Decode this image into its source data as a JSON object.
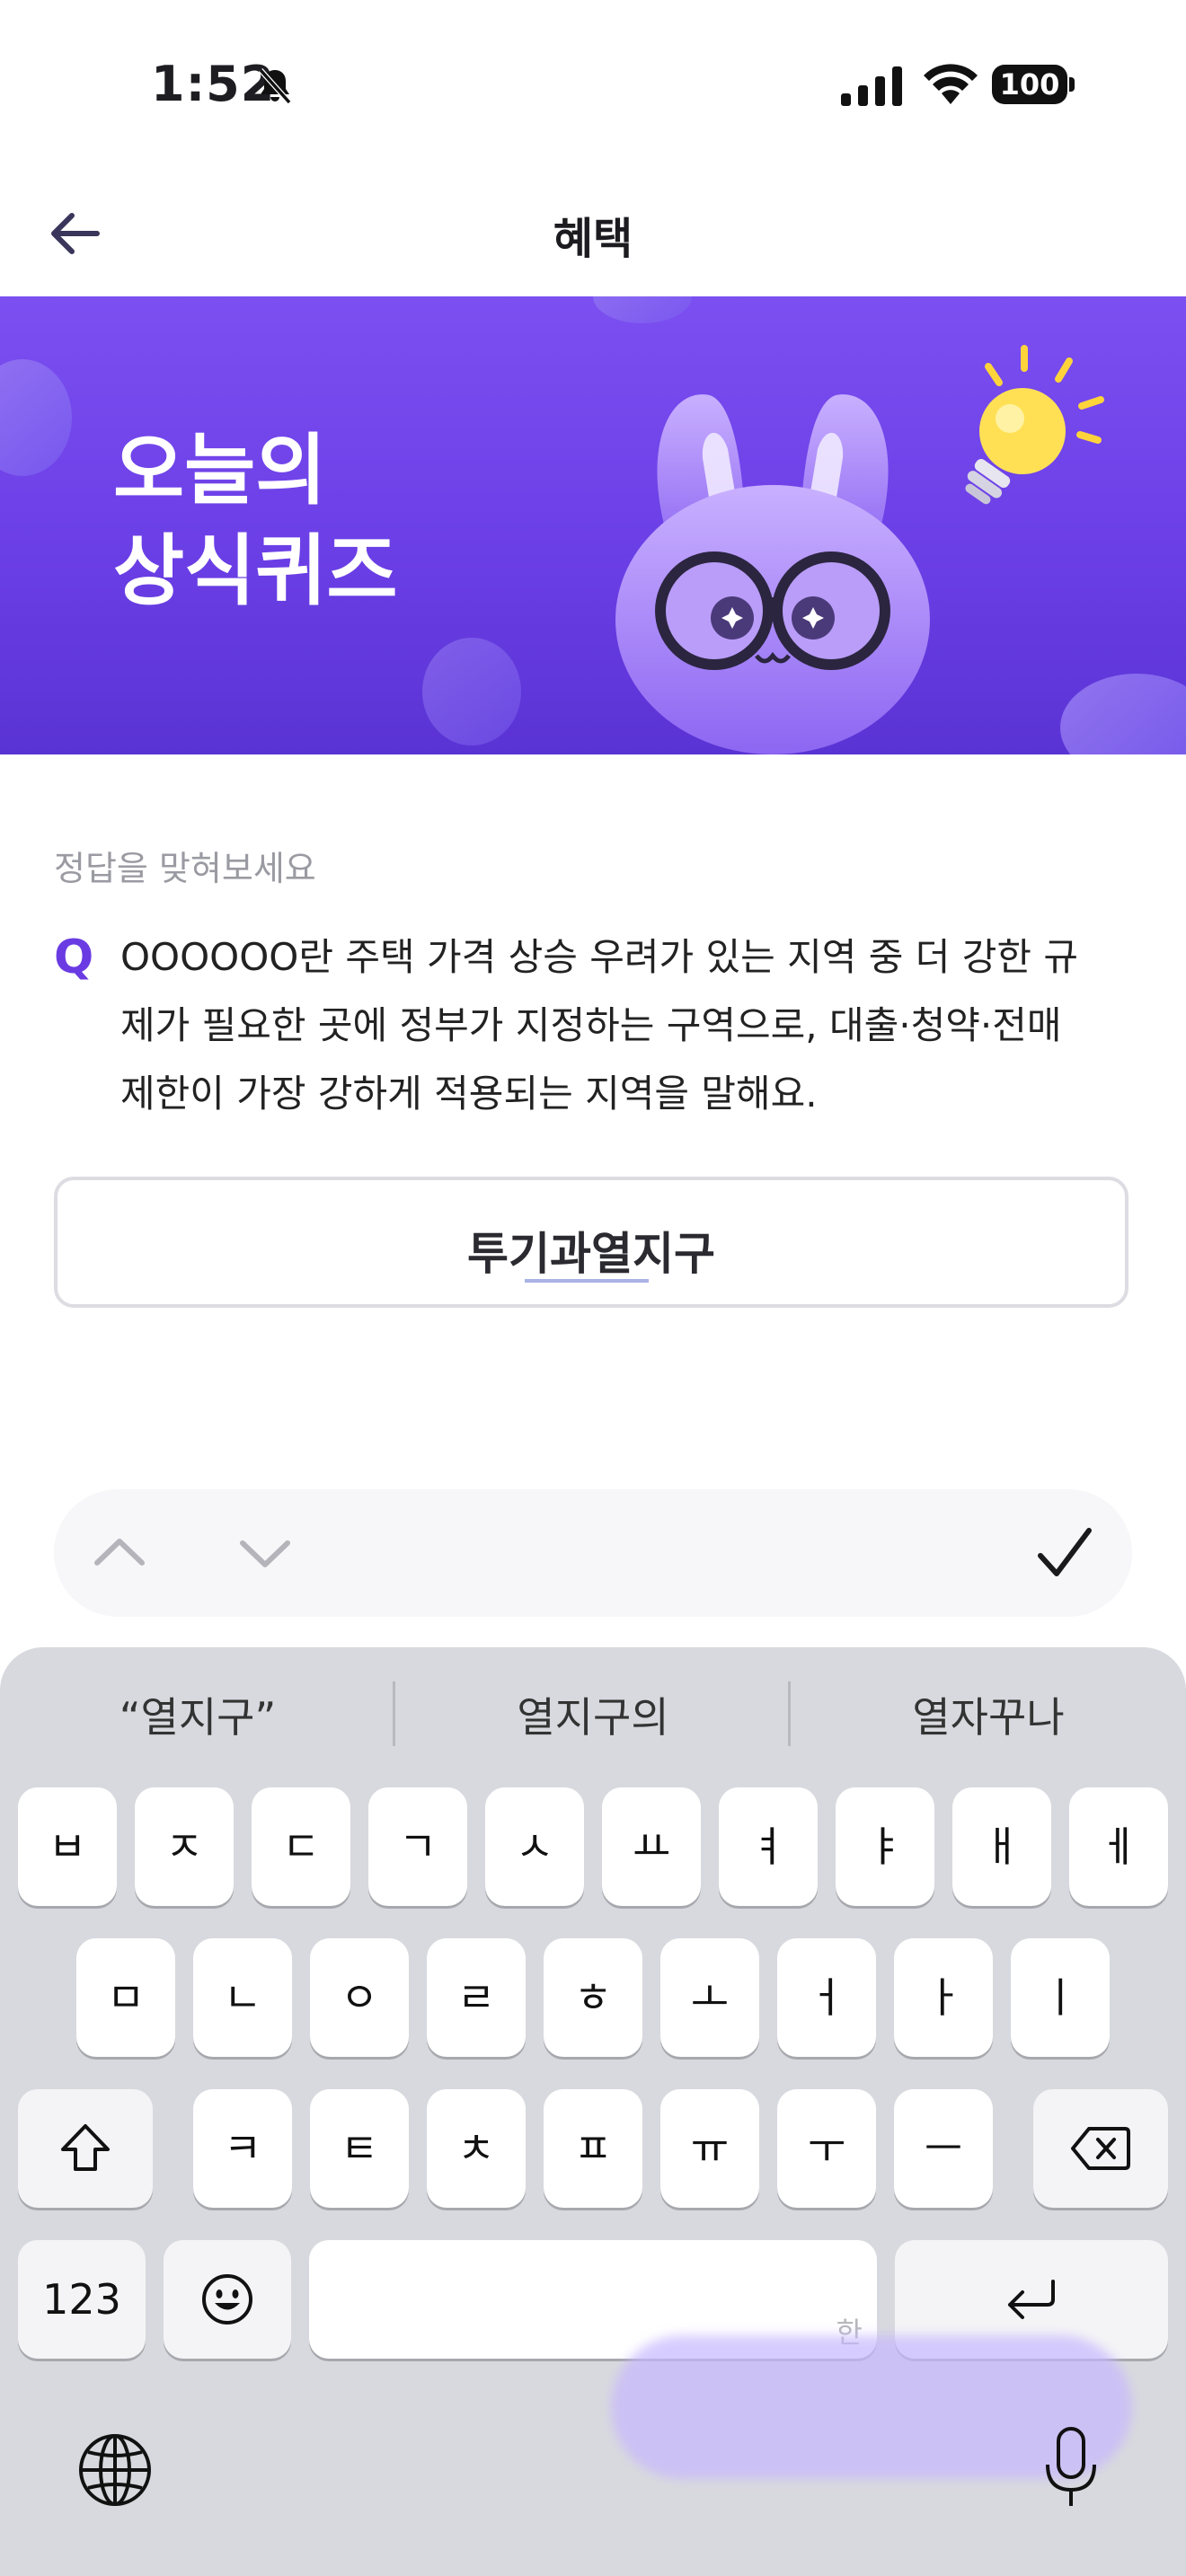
{
  "status_bar": {
    "time": "1:52",
    "battery": "100",
    "icons": [
      "bell-slash-icon",
      "signal-icon",
      "wifi-icon",
      "battery-icon"
    ]
  },
  "header": {
    "title": "혜택",
    "back_icon": "arrow-left-icon"
  },
  "banner": {
    "title_line1": "오늘의",
    "title_line2": "상식퀴즈",
    "illustration": "rabbit-mascot-with-glasses",
    "decoration": "lightbulb-icon",
    "colors": {
      "top": "#7b4ff0",
      "bottom": "#5a33d4"
    }
  },
  "quiz": {
    "hint": "정답을 맞혀보세요",
    "q_mark": "Q",
    "question_line1": "OOOOOO란 주택 가격 상승 우려가 있는 지역 중 더 강한 규",
    "question_line2": "제가 필요한 곳에 정부가 지정하는 구역으로, 대출·청약·전매",
    "question_line3": "제한이 가장 강하게 적용되는 지역을 말해요.",
    "answer_value": "투기과열지구",
    "accent_color": "#6a3be2"
  },
  "accessory": {
    "icons": [
      "chevron-up-icon",
      "chevron-down-icon",
      "checkmark-icon"
    ]
  },
  "keyboard": {
    "suggestions": [
      "“열지구”",
      "열지구의",
      "열자꾸나"
    ],
    "row1": [
      "ㅂ",
      "ㅈ",
      "ㄷ",
      "ㄱ",
      "ㅅ",
      "ㅛ",
      "ㅕ",
      "ㅑ",
      "ㅐ",
      "ㅔ"
    ],
    "row2": [
      "ㅁ",
      "ㄴ",
      "ㅇ",
      "ㄹ",
      "ㅎ",
      "ㅗ",
      "ㅓ",
      "ㅏ",
      "ㅣ"
    ],
    "row3": [
      "ㅋ",
      "ㅌ",
      "ㅊ",
      "ㅍ",
      "ㅠ",
      "ㅜ",
      "ㅡ"
    ],
    "numbers_key": "123",
    "space_hint": "한",
    "icons": [
      "shift-icon",
      "delete-icon",
      "emoji-icon",
      "return-icon",
      "globe-icon",
      "microphone-icon"
    ]
  }
}
